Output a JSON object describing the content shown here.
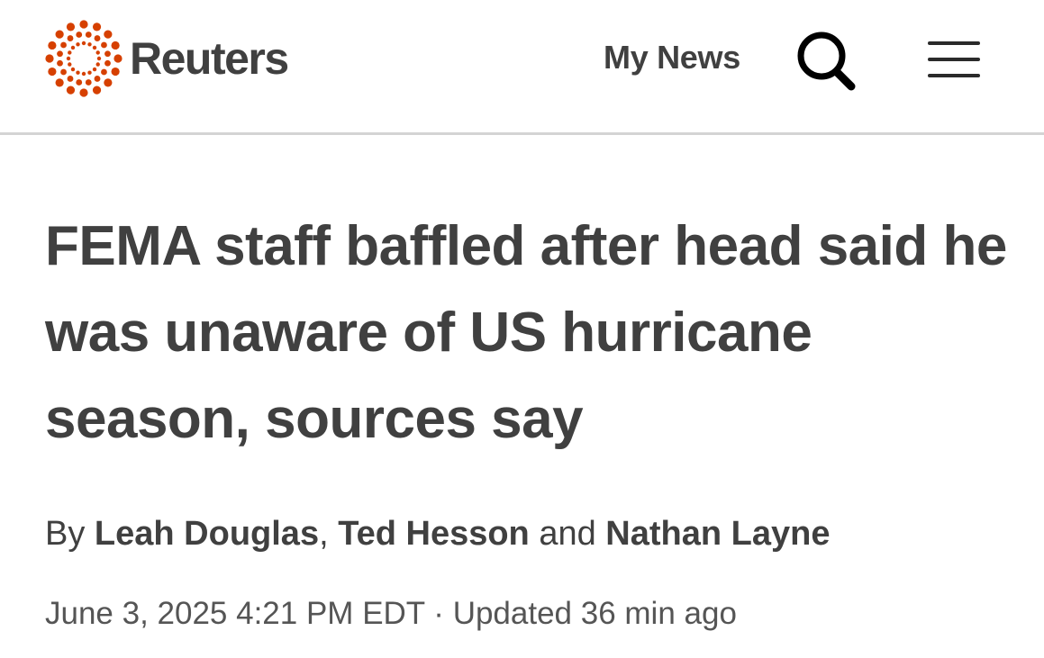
{
  "header": {
    "brand_name": "Reuters",
    "brand_color": "#d64000",
    "my_news_label": "My News",
    "search_icon": "search-icon",
    "menu_icon": "hamburger-menu-icon"
  },
  "article": {
    "headline": "FEMA staff baffled after head said he was unaware of US hurricane season, sources say",
    "byline": {
      "prefix": "By",
      "authors": [
        "Leah Douglas",
        "Ted Hesson",
        "Nathan Layne"
      ],
      "separator_1": ",",
      "separator_2": "and"
    },
    "published": "June 3, 2025 4:21 PM EDT",
    "dot_separator": "·",
    "updated": "Updated 36 min ago"
  },
  "colors": {
    "text": "#404040",
    "divider": "#d4d4d4",
    "background": "#ffffff"
  }
}
